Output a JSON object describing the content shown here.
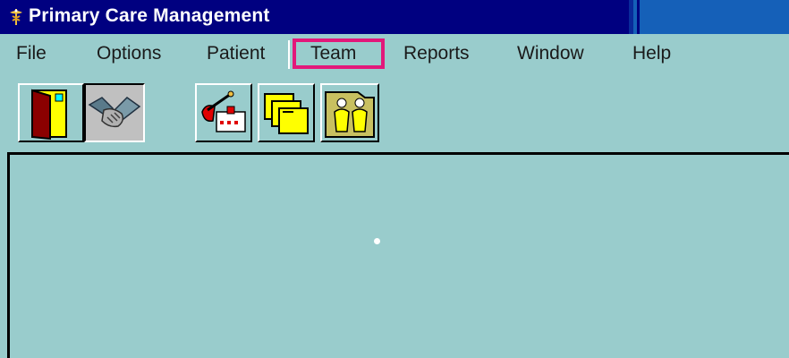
{
  "window": {
    "title": "Primary Care Management",
    "app_icon": "caduceus-icon"
  },
  "menu": {
    "items": [
      {
        "label": "File"
      },
      {
        "label": "Options"
      },
      {
        "label": "Patient"
      },
      {
        "label": "Team"
      },
      {
        "label": "Reports"
      },
      {
        "label": "Window"
      },
      {
        "label": "Help"
      }
    ],
    "highlighted": "Team",
    "highlight_color": "#e2187a"
  },
  "toolbar": {
    "buttons": [
      {
        "icon": "exit-door-icon",
        "pressed": false
      },
      {
        "icon": "handshake-icon",
        "pressed": true
      },
      {
        "icon": "clinic-visit-icon",
        "pressed": false
      },
      {
        "icon": "folders-icon",
        "pressed": false
      },
      {
        "icon": "team-members-icon",
        "pressed": false
      }
    ]
  },
  "colors": {
    "background": "#99cccc",
    "titlebar": "#000080",
    "title_text": "#ffffff"
  }
}
